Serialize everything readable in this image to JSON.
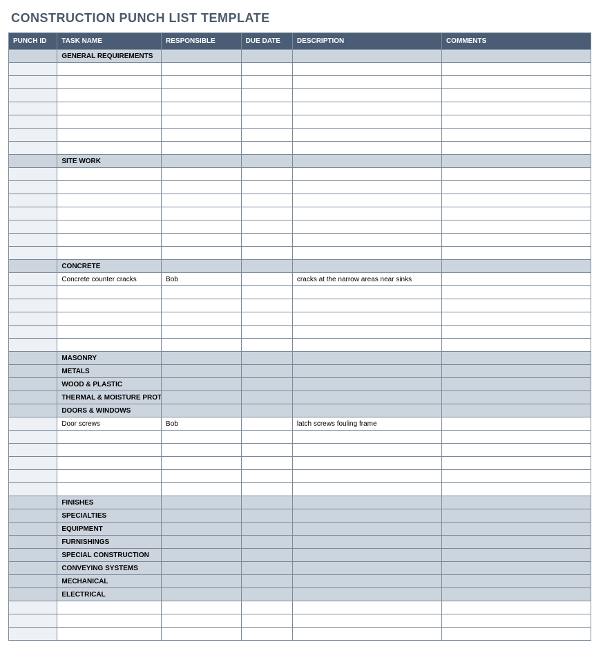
{
  "title": "CONSTRUCTION PUNCH LIST TEMPLATE",
  "columns": {
    "id": "PUNCH ID",
    "task": "TASK NAME",
    "resp": "RESPONSIBLE",
    "due": "DUE DATE",
    "desc": "DESCRIPTION",
    "comm": "COMMENTS"
  },
  "rows": [
    {
      "type": "section",
      "task": "GENERAL REQUIREMENTS"
    },
    {
      "type": "data"
    },
    {
      "type": "data"
    },
    {
      "type": "data"
    },
    {
      "type": "data"
    },
    {
      "type": "data"
    },
    {
      "type": "data"
    },
    {
      "type": "data"
    },
    {
      "type": "section",
      "task": "SITE WORK"
    },
    {
      "type": "data"
    },
    {
      "type": "data"
    },
    {
      "type": "data"
    },
    {
      "type": "data"
    },
    {
      "type": "data"
    },
    {
      "type": "data"
    },
    {
      "type": "data"
    },
    {
      "type": "section",
      "task": "CONCRETE"
    },
    {
      "type": "data",
      "task": "Concrete counter cracks",
      "resp": "Bob",
      "desc": "cracks at the narrow areas near sinks"
    },
    {
      "type": "data"
    },
    {
      "type": "data"
    },
    {
      "type": "data"
    },
    {
      "type": "data"
    },
    {
      "type": "data"
    },
    {
      "type": "section",
      "task": "MASONRY"
    },
    {
      "type": "section",
      "task": "METALS"
    },
    {
      "type": "section",
      "task": "WOOD & PLASTIC"
    },
    {
      "type": "section",
      "task": "THERMAL & MOISTURE PROTECTION"
    },
    {
      "type": "section",
      "task": "DOORS & WINDOWS"
    },
    {
      "type": "data",
      "task": "Door screws",
      "resp": "Bob",
      "desc": "latch screws fouling frame"
    },
    {
      "type": "data"
    },
    {
      "type": "data"
    },
    {
      "type": "data"
    },
    {
      "type": "data"
    },
    {
      "type": "data"
    },
    {
      "type": "section",
      "task": "FINISHES"
    },
    {
      "type": "section",
      "task": "SPECIALTIES"
    },
    {
      "type": "section",
      "task": "EQUIPMENT"
    },
    {
      "type": "section",
      "task": "FURNISHINGS"
    },
    {
      "type": "section",
      "task": "SPECIAL CONSTRUCTION"
    },
    {
      "type": "section",
      "task": "CONVEYING SYSTEMS"
    },
    {
      "type": "section",
      "task": "MECHANICAL"
    },
    {
      "type": "section",
      "task": "ELECTRICAL"
    },
    {
      "type": "data"
    },
    {
      "type": "data"
    },
    {
      "type": "data"
    }
  ]
}
